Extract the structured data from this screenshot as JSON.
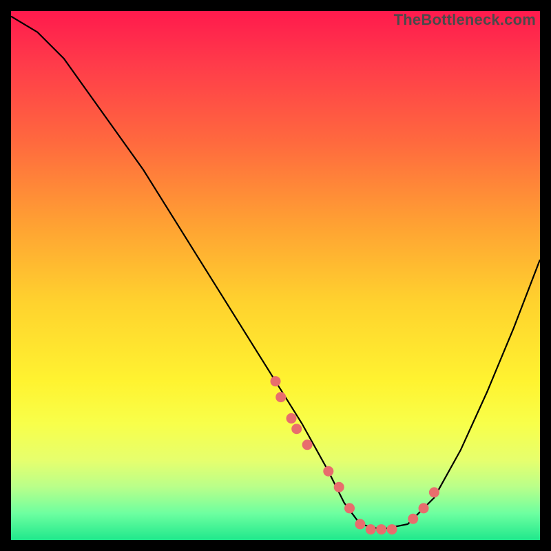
{
  "watermark": "TheBottleneck.com",
  "colors": {
    "dot": "#e86d6d",
    "curve": "#000000"
  },
  "chart_data": {
    "type": "line",
    "title": "",
    "xlabel": "",
    "ylabel": "",
    "xlim": [
      0,
      100
    ],
    "ylim": [
      0,
      100
    ],
    "grid": false,
    "legend": false,
    "series": [
      {
        "name": "bottleneck-curve",
        "x": [
          0,
          5,
          10,
          15,
          20,
          25,
          30,
          35,
          40,
          45,
          50,
          55,
          60,
          63,
          66,
          70,
          75,
          80,
          85,
          90,
          95,
          100
        ],
        "y": [
          99,
          96,
          91,
          84,
          77,
          70,
          62,
          54,
          46,
          38,
          30,
          22,
          13,
          7,
          3,
          2,
          3,
          8,
          17,
          28,
          40,
          53
        ]
      }
    ],
    "scatter": {
      "name": "highlighted-points",
      "x": [
        50,
        51,
        53,
        54,
        56,
        60,
        62,
        64,
        66,
        68,
        70,
        72,
        76,
        78,
        80
      ],
      "y": [
        30,
        27,
        23,
        21,
        18,
        13,
        10,
        6,
        3,
        2,
        2,
        2,
        4,
        6,
        9
      ]
    }
  }
}
